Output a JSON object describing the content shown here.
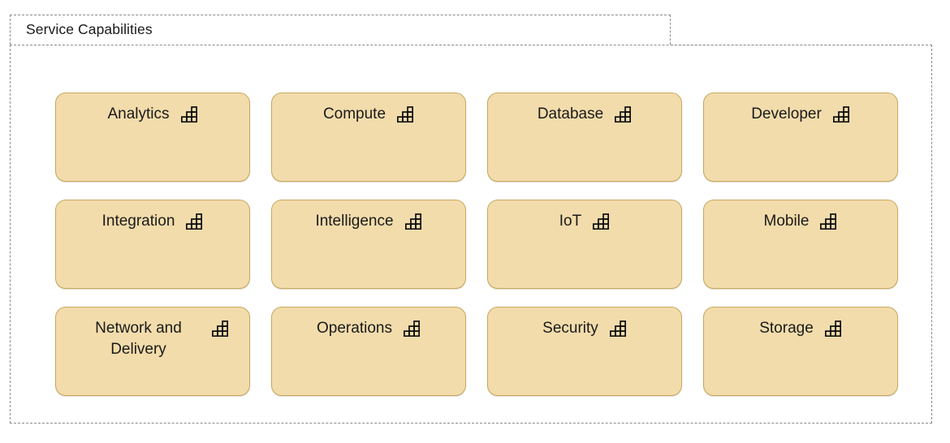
{
  "grouping": {
    "title": "Service Capabilities",
    "border_style": "dashed",
    "border_color": "#8a8a8a"
  },
  "card_style": {
    "fill": "#f2dcab",
    "border": "#c8a860",
    "text": "#1a1a1a",
    "icon_name": "grouping-icon"
  },
  "grid": {
    "columns": 4,
    "rows": 3,
    "cards": [
      {
        "label": "Analytics",
        "icon": "grouping-icon"
      },
      {
        "label": "Compute",
        "icon": "grouping-icon"
      },
      {
        "label": "Database",
        "icon": "grouping-icon"
      },
      {
        "label": "Developer",
        "icon": "grouping-icon"
      },
      {
        "label": "Integration",
        "icon": "grouping-icon"
      },
      {
        "label": "Intelligence",
        "icon": "grouping-icon"
      },
      {
        "label": "IoT",
        "icon": "grouping-icon"
      },
      {
        "label": "Mobile",
        "icon": "grouping-icon"
      },
      {
        "label": "Network and Delivery",
        "icon": "grouping-icon"
      },
      {
        "label": "Operations",
        "icon": "grouping-icon"
      },
      {
        "label": "Security",
        "icon": "grouping-icon"
      },
      {
        "label": "Storage",
        "icon": "grouping-icon"
      }
    ]
  }
}
